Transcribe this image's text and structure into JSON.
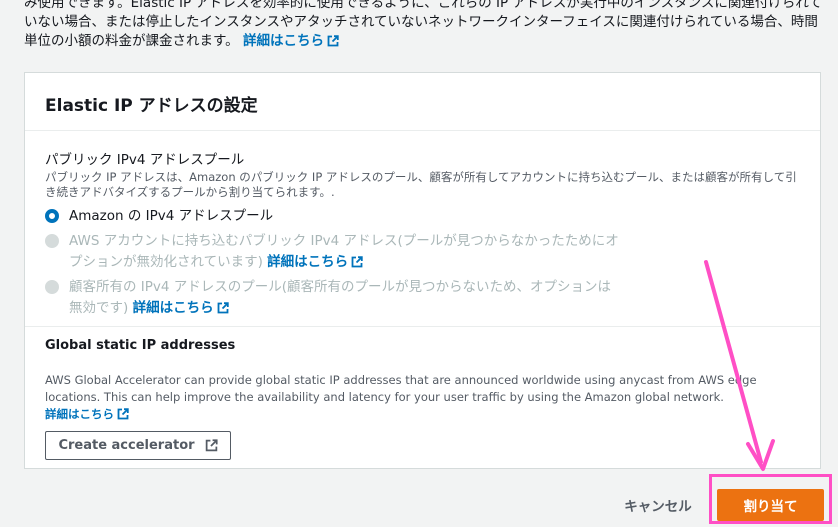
{
  "intro": {
    "text": "み使用できます。Elastic IP アドレスを効率的に使用できるように、これらの IP アドレスが実行中のインスタンスに関連付けられていない場合、または停止したインスタンスやアタッチされていないネットワークインターフェイスに関連付けられている場合、時間単位の小額の料金が課金されます。",
    "link": "詳細はこちら"
  },
  "panel": {
    "title": "Elastic IP アドレスの設定",
    "pool_section": {
      "title": "パブリック IPv4 アドレスプール",
      "description": "パブリック IP アドレスは、Amazon のパブリック IP アドレスのプール、顧客が所有してアカウントに持ち込むプール、または顧客が所有して引き続きアドバタイズするプールから割り当てられます。.",
      "options": [
        {
          "label": "Amazon の IPv4 アドレスプール",
          "selected": true,
          "disabled": false
        },
        {
          "label": "AWS アカウントに持ち込むパブリック IPv4 アドレス(プールが見つからなかったためにオプションが無効化されています)",
          "link": "詳細はこちら",
          "selected": false,
          "disabled": true
        },
        {
          "label": "顧客所有の IPv4 アドレスのプール(顧客所有のプールが見つからないため、オプションは無効です)",
          "link": "詳細はこちら",
          "selected": false,
          "disabled": true
        }
      ]
    },
    "global_section": {
      "title": "Global static IP addresses",
      "description": "AWS Global Accelerator can provide global static IP addresses that are announced worldwide using anycast from AWS edge locations. This can help improve the availability and latency for your user traffic by using the Amazon global network.",
      "link": "詳細はこちら",
      "button_label": "Create accelerator"
    }
  },
  "footer": {
    "cancel_label": "キャンセル",
    "submit_label": "割り当て"
  },
  "colors": {
    "primary": "#ec7211",
    "link": "#0073bb",
    "annotation": "#ff4fc5"
  }
}
